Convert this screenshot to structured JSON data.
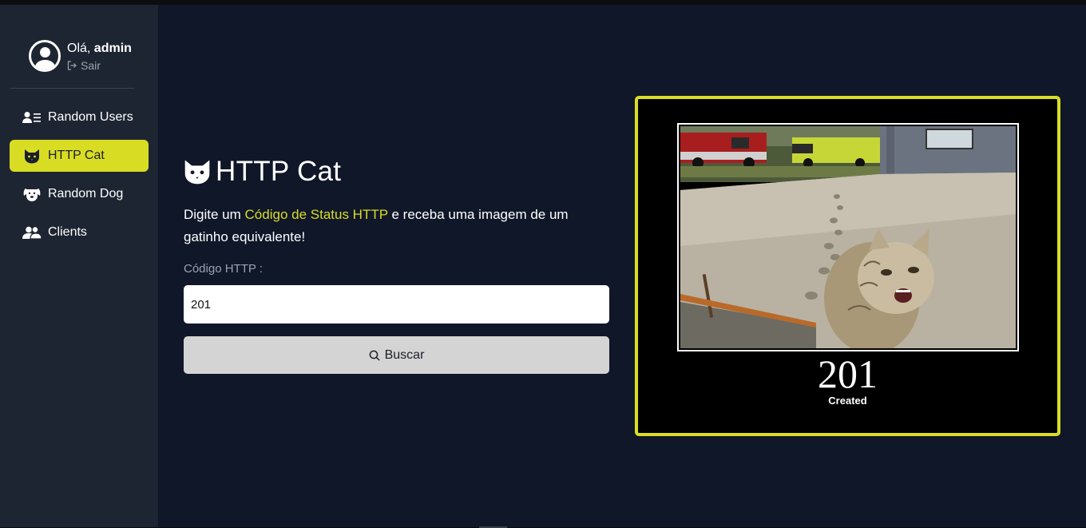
{
  "user": {
    "greeting_prefix": "Olá,",
    "username": "admin",
    "logout_label": "Sair"
  },
  "sidebar": {
    "items": [
      {
        "label": "Random Users",
        "icon": "users-list-icon",
        "active": false
      },
      {
        "label": "HTTP Cat",
        "icon": "cat-icon",
        "active": true
      },
      {
        "label": "Random Dog",
        "icon": "dog-icon",
        "active": false
      },
      {
        "label": "Clients",
        "icon": "clients-icon",
        "active": false
      }
    ]
  },
  "page": {
    "title": "HTTP Cat",
    "description_before": "Digite um ",
    "description_highlight": "Código de Status HTTP",
    "description_after": " e receba uma imagem de um gatinho equivalente!",
    "field_label": "Código HTTP :",
    "input_value": "201",
    "search_button_label": "Buscar"
  },
  "result": {
    "code": "201",
    "status": "Created"
  },
  "colors": {
    "accent": "#d8dd24",
    "sidebar_bg": "#1e2532",
    "main_bg": "#101729"
  }
}
